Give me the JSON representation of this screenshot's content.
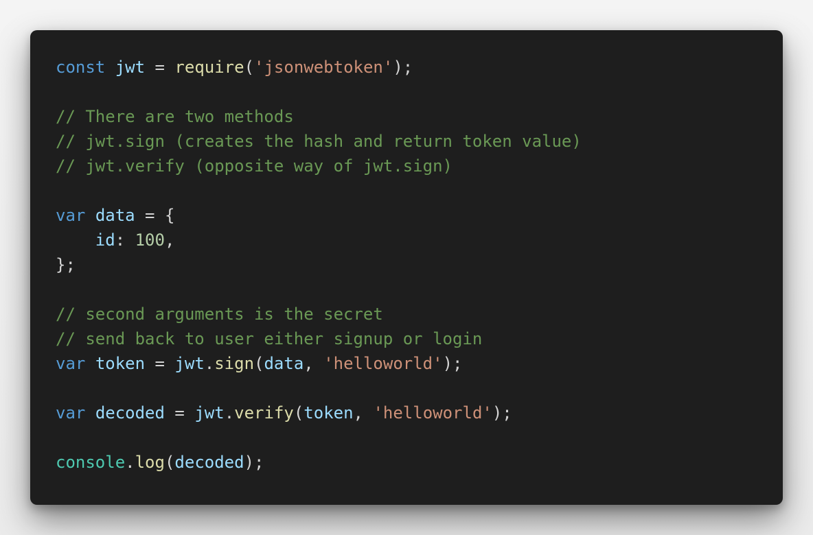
{
  "colors": {
    "background": "#1e1e1e",
    "keyword": "#569cd6",
    "variable": "#9cdcfe",
    "function": "#dcdcaa",
    "string": "#ce9178",
    "number": "#b5cea8",
    "comment": "#6a9955",
    "class": "#4ec9b0",
    "punctuation": "#d4d4d4"
  },
  "code": {
    "lines": [
      [
        {
          "t": "keyword",
          "v": "const"
        },
        {
          "t": "punct",
          "v": " "
        },
        {
          "t": "var",
          "v": "jwt"
        },
        {
          "t": "punct",
          "v": " = "
        },
        {
          "t": "func",
          "v": "require"
        },
        {
          "t": "punct",
          "v": "("
        },
        {
          "t": "string",
          "v": "'jsonwebtoken'"
        },
        {
          "t": "punct",
          "v": ");"
        }
      ],
      [],
      [
        {
          "t": "comment",
          "v": "// There are two methods"
        }
      ],
      [
        {
          "t": "comment",
          "v": "// jwt.sign (creates the hash and return token value)"
        }
      ],
      [
        {
          "t": "comment",
          "v": "// jwt.verify (opposite way of jwt.sign)"
        }
      ],
      [],
      [
        {
          "t": "keyword",
          "v": "var"
        },
        {
          "t": "punct",
          "v": " "
        },
        {
          "t": "var",
          "v": "data"
        },
        {
          "t": "punct",
          "v": " = {"
        }
      ],
      [
        {
          "t": "punct",
          "v": "    "
        },
        {
          "t": "var",
          "v": "id"
        },
        {
          "t": "punct",
          "v": ": "
        },
        {
          "t": "number",
          "v": "100"
        },
        {
          "t": "punct",
          "v": ","
        }
      ],
      [
        {
          "t": "punct",
          "v": "};"
        }
      ],
      [],
      [
        {
          "t": "comment",
          "v": "// second arguments is the secret"
        }
      ],
      [
        {
          "t": "comment",
          "v": "// send back to user either signup or login"
        }
      ],
      [
        {
          "t": "keyword",
          "v": "var"
        },
        {
          "t": "punct",
          "v": " "
        },
        {
          "t": "var",
          "v": "token"
        },
        {
          "t": "punct",
          "v": " = "
        },
        {
          "t": "var",
          "v": "jwt"
        },
        {
          "t": "punct",
          "v": "."
        },
        {
          "t": "func",
          "v": "sign"
        },
        {
          "t": "punct",
          "v": "("
        },
        {
          "t": "var",
          "v": "data"
        },
        {
          "t": "punct",
          "v": ", "
        },
        {
          "t": "string",
          "v": "'helloworld'"
        },
        {
          "t": "punct",
          "v": ");"
        }
      ],
      [],
      [
        {
          "t": "keyword",
          "v": "var"
        },
        {
          "t": "punct",
          "v": " "
        },
        {
          "t": "var",
          "v": "decoded"
        },
        {
          "t": "punct",
          "v": " = "
        },
        {
          "t": "var",
          "v": "jwt"
        },
        {
          "t": "punct",
          "v": "."
        },
        {
          "t": "func",
          "v": "verify"
        },
        {
          "t": "punct",
          "v": "("
        },
        {
          "t": "var",
          "v": "token"
        },
        {
          "t": "punct",
          "v": ", "
        },
        {
          "t": "string",
          "v": "'helloworld'"
        },
        {
          "t": "punct",
          "v": ");"
        }
      ],
      [],
      [
        {
          "t": "class",
          "v": "console"
        },
        {
          "t": "punct",
          "v": "."
        },
        {
          "t": "func",
          "v": "log"
        },
        {
          "t": "punct",
          "v": "("
        },
        {
          "t": "var",
          "v": "decoded"
        },
        {
          "t": "punct",
          "v": ");"
        }
      ]
    ]
  }
}
